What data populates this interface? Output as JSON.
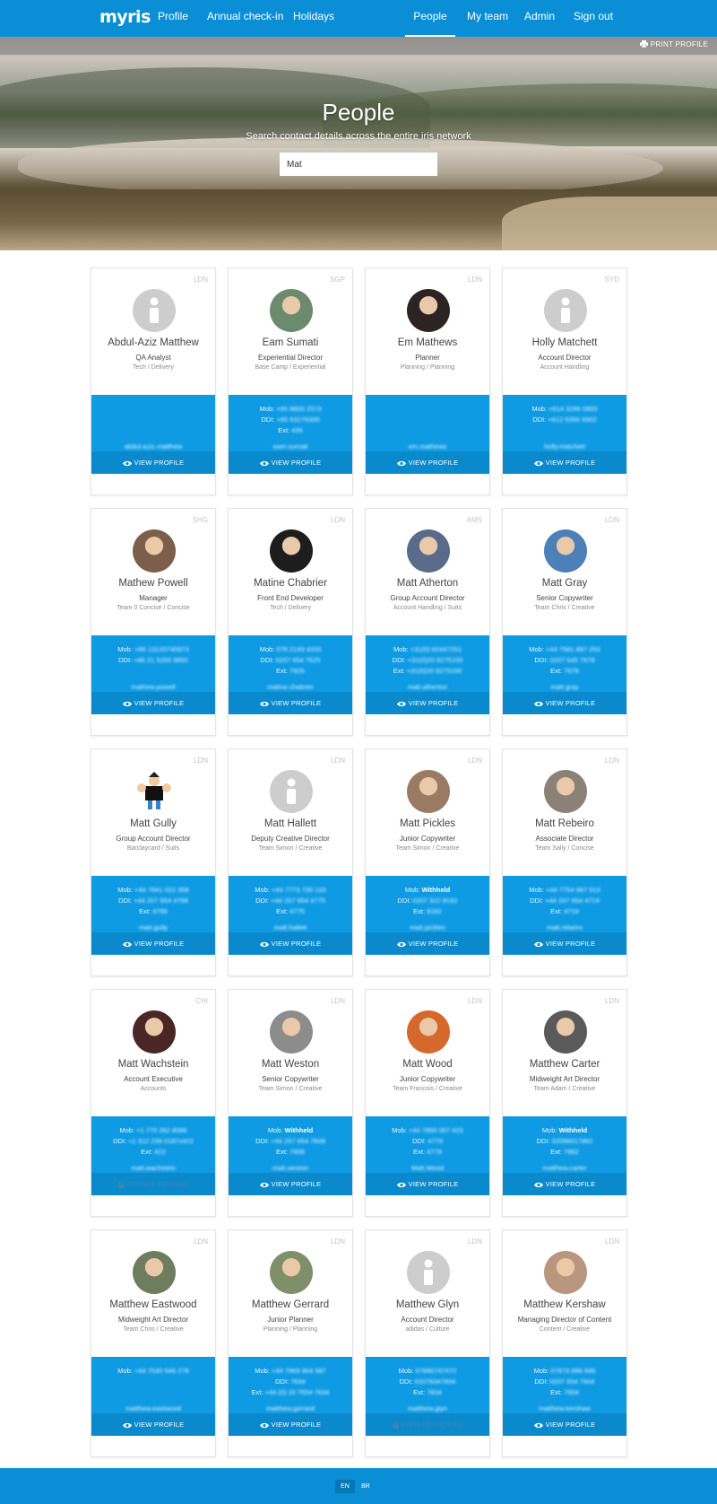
{
  "nav": {
    "logo": "myris",
    "left": [
      "Profile",
      "Annual check-in",
      "Holidays"
    ],
    "right": [
      "People",
      "My team",
      "Admin",
      "Sign out"
    ],
    "active": "People"
  },
  "hero": {
    "print_label": "PRINT PROFILE",
    "title": "People",
    "subtitle": "Search contact details across the entire iris network",
    "search_value": "Mat"
  },
  "view_profile_label": "VIEW PROFILE",
  "private_profile_label": "PRIVATE PROFILE",
  "people": [
    {
      "office": "LDN",
      "name": "Abdul-Aziz Matthew",
      "role": "QA Analyst",
      "team": "Tech / Delivery",
      "mob": "",
      "ddi": "",
      "ext": "",
      "email1": "abdul-aziz.matthew",
      "email2": "@iris-worldwide.com",
      "avatar": "placeholder",
      "private": false
    },
    {
      "office": "SGP",
      "name": "Eam Sumati",
      "role": "Experiential Director",
      "team": "Base Camp / Experiential",
      "mob": "+65 9800 2573",
      "ddi": "+65 63276300",
      "ext": "436",
      "email1": "eam.sumati",
      "email2": "@iris-worldwide.com",
      "avatar": "photo",
      "color": "#6c8a6e",
      "private": false
    },
    {
      "office": "LDN",
      "name": "Em Mathews",
      "role": "Planner",
      "team": "Planning / Planning",
      "mob": "",
      "ddi": "",
      "ext": "",
      "email1": "em.mathews",
      "email2": "@iris-worldwide.com",
      "avatar": "photo",
      "color": "#2c2424",
      "private": false
    },
    {
      "office": "SYD",
      "name": "Holly Matchett",
      "role": "Account Director",
      "team": "Account Handling",
      "mob": "+614 3266 0893",
      "ddi": "+612 9356 9302",
      "ext": "",
      "email1": "holly.matchett",
      "email2": "@iris-worldwide.com",
      "avatar": "placeholder",
      "private": false
    },
    {
      "office": "SHG",
      "name": "Mathew Powell",
      "role": "Manager",
      "team": "Team 0 Concise / Concise",
      "mob": "+86 13120745973",
      "ddi": "+86 21 5265 9850",
      "ext": "",
      "email1": "mathew.powell",
      "email2": "@iris-worldwide.com",
      "avatar": "photo",
      "color": "#7d5e4a",
      "private": false
    },
    {
      "office": "LDN",
      "name": "Matine Chabrier",
      "role": "Front End Developer",
      "team": "Tech / Delivery",
      "mob": "078 2149 4200",
      "ddi": "0207 654 7625",
      "ext": "7625",
      "email1": "matine.chabrier",
      "email2": "@iris-worldwide.com",
      "avatar": "photo",
      "color": "#1d1d1d",
      "private": false
    },
    {
      "office": "AMS",
      "name": "Matt Atherton",
      "role": "Group Account Director",
      "team": "Account Handling / Suits",
      "mob": "+31(0) 62447251",
      "ddi": "+31(0)20 6275100",
      "ext": "+31(0)20 6275100",
      "email1": "matt.atherton",
      "email2": "@iris-worldwide.com",
      "avatar": "photo",
      "color": "#5a6a8a",
      "private": false
    },
    {
      "office": "LDN",
      "name": "Matt Gray",
      "role": "Senior Copywriter",
      "team": "Team Chris / Creative",
      "mob": "+44 7581 897 253",
      "ddi": "0207 645 7678",
      "ext": "7678",
      "email1": "matt.gray",
      "email2": "@iris-worldwide.com",
      "avatar": "photo",
      "color": "#4d7fb8",
      "private": false
    },
    {
      "office": "LDN",
      "name": "Matt Gully",
      "role": "Group Account Director",
      "team": "Barclaycard / Suits",
      "mob": "+44 7841 022 358",
      "ddi": "+44 207 654 4799",
      "ext": "4799",
      "email1": "matt.gully",
      "email2": "@iris-worldwide.com",
      "avatar": "cartoon",
      "color": "#ffffff",
      "private": false
    },
    {
      "office": "LDN",
      "name": "Matt Hallett",
      "role": "Deputy Creative Director",
      "team": "Team Simon / Creative",
      "mob": "+44 7773 735 133",
      "ddi": "+44 207 654 4775",
      "ext": "4775",
      "email1": "matt.hallett",
      "email2": "@iris-worldwide.com",
      "avatar": "placeholder",
      "private": false
    },
    {
      "office": "LDN",
      "name": "Matt Pickles",
      "role": "Junior Copywriter",
      "team": "Team Simon / Creative",
      "mob": "Withheld",
      "ddi": "0207 922 8182",
      "ext": "8182",
      "email1": "matt.pickles",
      "email2": "@iris-worldwide.com",
      "avatar": "photo",
      "color": "#9a7a62",
      "private": false
    },
    {
      "office": "LDN",
      "name": "Matt Rebeiro",
      "role": "Associate Director",
      "team": "Team Sally / Concise",
      "mob": "+44 7754 967 513",
      "ddi": "+44 207 654 4719",
      "ext": "4719",
      "email1": "matt.rebeiro",
      "email2": "@iris-worldwide.com",
      "avatar": "photo",
      "color": "#8a8276",
      "private": false
    },
    {
      "office": "CHI",
      "name": "Matt Wachstein",
      "role": "Account Executive",
      "team": "Accounts",
      "mob": "+1 770 262 8086",
      "ddi": "+1 312 239 0187x422",
      "ext": "422",
      "email1": "matt.wachstein",
      "email2": "@iris-worldwide.com",
      "avatar": "photo",
      "color": "#4a2626",
      "private": true
    },
    {
      "office": "LDN",
      "name": "Matt Weston",
      "role": "Senior Copywriter",
      "team": "Team Simon / Creative",
      "mob": "Withheld",
      "ddi": "+44 207 654 7608",
      "ext": "7608",
      "email1": "matt.weston",
      "email2": "@iris-worldwide.com",
      "avatar": "photo",
      "color": "#8c8c8c",
      "private": false
    },
    {
      "office": "LDN",
      "name": "Matt Wood",
      "role": "Junior Copywriter",
      "team": "Team Francois / Creative",
      "mob": "+44 7856 057 623",
      "ddi": "4779",
      "ext": "4779",
      "email1": "Matt.Wood",
      "email2": "@iris-worldwide.com",
      "avatar": "photo",
      "color": "#d5682b",
      "private": false
    },
    {
      "office": "LDN",
      "name": "Matthew Carter",
      "role": "Midweight Art Director",
      "team": "Team Adam / Creative",
      "mob": "Withheld",
      "ddi": "02099017862",
      "ext": "7862",
      "email1": "matthew.carter",
      "email2": "@iris-worldwide.com",
      "avatar": "photo",
      "color": "#5a5a5a",
      "private": false
    },
    {
      "office": "LDN",
      "name": "Matthew Eastwood",
      "role": "Midweight Art Director",
      "team": "Team Chris / Creative",
      "mob": "+44 7530 546 278",
      "ddi": "",
      "ext": "",
      "email1": "matthew.eastwood",
      "email2": "@iris-worldwide.com",
      "avatar": "photo",
      "color": "#6d7d5e",
      "private": false
    },
    {
      "office": "LDN",
      "name": "Matthew Gerrard",
      "role": "Junior Planner",
      "team": "Planning / Planning",
      "mob": "+44 7969 904 587",
      "ddi": "7634",
      "ext": "+44 (0) 20 7654 7634",
      "email1": "matthew.gerrard",
      "email2": "@iris-worldwide.com",
      "avatar": "photo",
      "color": "#7f8f6a",
      "private": false
    },
    {
      "office": "LDN",
      "name": "Matthew Glyn",
      "role": "Account Director",
      "team": "adidas / Culture",
      "mob": "07880747472",
      "ddi": "02078347834",
      "ext": "7834",
      "email1": "matthew.glyn",
      "email2": "@iris-worldwide.com",
      "avatar": "placeholder",
      "private": true
    },
    {
      "office": "LDN",
      "name": "Matthew Kershaw",
      "role": "Managing Director of Content",
      "team": "Content / Creative",
      "mob": "07973 886 696",
      "ddi": "0207 654 7604",
      "ext": "7604",
      "email1": "matthew.kershaw",
      "email2": "@iris-worldwide.com",
      "avatar": "photo",
      "color": "#b9967e",
      "private": false
    }
  ],
  "footer": {
    "langs": [
      "EN",
      "BR"
    ],
    "active": "EN"
  }
}
